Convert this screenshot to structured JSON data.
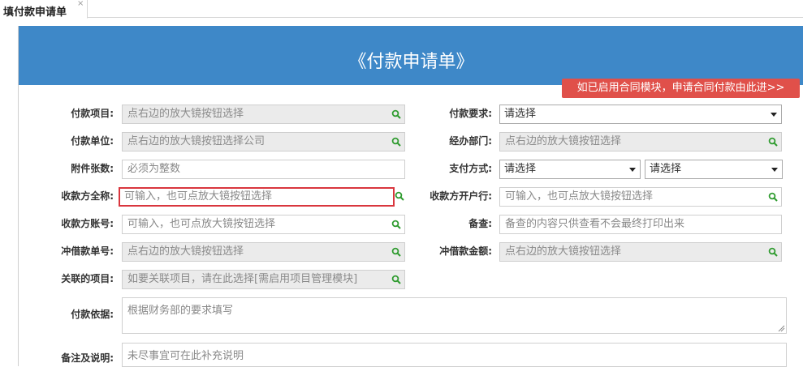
{
  "tab": {
    "title": "填付款申请单",
    "close": "×"
  },
  "header": {
    "title": "《付款申请单》"
  },
  "contract_link": "如已启用合同模块，申请合同付款由此进>>",
  "fields": {
    "project": {
      "label": "付款项目:",
      "placeholder": "点右边的放大镜按钮选择"
    },
    "unit": {
      "label": "付款单位:",
      "placeholder": "点右边的放大镜按钮选择公司"
    },
    "attachments": {
      "label": "附件张数:",
      "placeholder": "必须为整数"
    },
    "payee_name": {
      "label": "收款方全称:",
      "placeholder": "可输入，也可点放大镜按钮选择"
    },
    "payee_account": {
      "label": "收款方账号:",
      "placeholder": "可输入，也可点放大镜按钮选择"
    },
    "offset_doc": {
      "label": "冲借款单号:",
      "placeholder": "点右边的放大镜按钮选择"
    },
    "related_project": {
      "label": "关联的项目:",
      "placeholder": "如要关联项目，请在此选择[需启用项目管理模块]"
    },
    "basis": {
      "label": "付款依据:",
      "placeholder": "根据财务部的要求填写"
    },
    "remarks": {
      "label": "备注及说明:",
      "placeholder": "未尽事宜可在此补充说明"
    },
    "requirement": {
      "label": "付款要求:",
      "value": "请选择"
    },
    "department": {
      "label": "经办部门:",
      "placeholder": "点右边的放大镜按钮选择"
    },
    "pay_method": {
      "label": "支付方式:",
      "value1": "请选择",
      "value2": "请选择"
    },
    "payee_bank": {
      "label": "收款方开户行:",
      "placeholder": "可输入，也可点放大镜按钮选择"
    },
    "memo": {
      "label": "备查:",
      "placeholder": "备查的内容只供查看不会最终打印出来"
    },
    "offset_amount": {
      "label": "冲借款金额:",
      "placeholder": "点右边的放大镜按钮选择"
    }
  },
  "colors": {
    "header_bg": "#3e88c8",
    "red_button": "#e0504a",
    "search_icon": "#2e9b2e",
    "highlight_border": "#d9363e"
  },
  "icons": {
    "search": "magnifier-icon"
  }
}
